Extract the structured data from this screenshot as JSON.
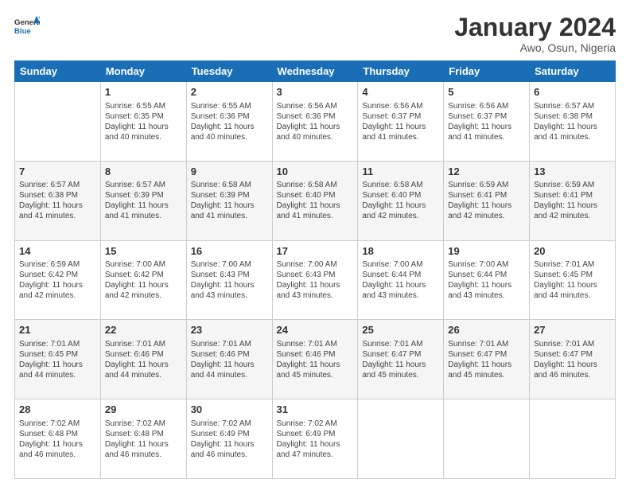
{
  "header": {
    "logo_text_general": "General",
    "logo_text_blue": "Blue",
    "month_title": "January 2024",
    "location": "Awo, Osun, Nigeria"
  },
  "days_of_week": [
    "Sunday",
    "Monday",
    "Tuesday",
    "Wednesday",
    "Thursday",
    "Friday",
    "Saturday"
  ],
  "weeks": [
    [
      {
        "day": "",
        "info": ""
      },
      {
        "day": "1",
        "info": "Sunrise: 6:55 AM\nSunset: 6:35 PM\nDaylight: 11 hours\nand 40 minutes."
      },
      {
        "day": "2",
        "info": "Sunrise: 6:55 AM\nSunset: 6:36 PM\nDaylight: 11 hours\nand 40 minutes."
      },
      {
        "day": "3",
        "info": "Sunrise: 6:56 AM\nSunset: 6:36 PM\nDaylight: 11 hours\nand 40 minutes."
      },
      {
        "day": "4",
        "info": "Sunrise: 6:56 AM\nSunset: 6:37 PM\nDaylight: 11 hours\nand 41 minutes."
      },
      {
        "day": "5",
        "info": "Sunrise: 6:56 AM\nSunset: 6:37 PM\nDaylight: 11 hours\nand 41 minutes."
      },
      {
        "day": "6",
        "info": "Sunrise: 6:57 AM\nSunset: 6:38 PM\nDaylight: 11 hours\nand 41 minutes."
      }
    ],
    [
      {
        "day": "7",
        "info": "Sunrise: 6:57 AM\nSunset: 6:38 PM\nDaylight: 11 hours\nand 41 minutes."
      },
      {
        "day": "8",
        "info": "Sunrise: 6:57 AM\nSunset: 6:39 PM\nDaylight: 11 hours\nand 41 minutes."
      },
      {
        "day": "9",
        "info": "Sunrise: 6:58 AM\nSunset: 6:39 PM\nDaylight: 11 hours\nand 41 minutes."
      },
      {
        "day": "10",
        "info": "Sunrise: 6:58 AM\nSunset: 6:40 PM\nDaylight: 11 hours\nand 41 minutes."
      },
      {
        "day": "11",
        "info": "Sunrise: 6:58 AM\nSunset: 6:40 PM\nDaylight: 11 hours\nand 42 minutes."
      },
      {
        "day": "12",
        "info": "Sunrise: 6:59 AM\nSunset: 6:41 PM\nDaylight: 11 hours\nand 42 minutes."
      },
      {
        "day": "13",
        "info": "Sunrise: 6:59 AM\nSunset: 6:41 PM\nDaylight: 11 hours\nand 42 minutes."
      }
    ],
    [
      {
        "day": "14",
        "info": "Sunrise: 6:59 AM\nSunset: 6:42 PM\nDaylight: 11 hours\nand 42 minutes."
      },
      {
        "day": "15",
        "info": "Sunrise: 7:00 AM\nSunset: 6:42 PM\nDaylight: 11 hours\nand 42 minutes."
      },
      {
        "day": "16",
        "info": "Sunrise: 7:00 AM\nSunset: 6:43 PM\nDaylight: 11 hours\nand 43 minutes."
      },
      {
        "day": "17",
        "info": "Sunrise: 7:00 AM\nSunset: 6:43 PM\nDaylight: 11 hours\nand 43 minutes."
      },
      {
        "day": "18",
        "info": "Sunrise: 7:00 AM\nSunset: 6:44 PM\nDaylight: 11 hours\nand 43 minutes."
      },
      {
        "day": "19",
        "info": "Sunrise: 7:00 AM\nSunset: 6:44 PM\nDaylight: 11 hours\nand 43 minutes."
      },
      {
        "day": "20",
        "info": "Sunrise: 7:01 AM\nSunset: 6:45 PM\nDaylight: 11 hours\nand 44 minutes."
      }
    ],
    [
      {
        "day": "21",
        "info": "Sunrise: 7:01 AM\nSunset: 6:45 PM\nDaylight: 11 hours\nand 44 minutes."
      },
      {
        "day": "22",
        "info": "Sunrise: 7:01 AM\nSunset: 6:46 PM\nDaylight: 11 hours\nand 44 minutes."
      },
      {
        "day": "23",
        "info": "Sunrise: 7:01 AM\nSunset: 6:46 PM\nDaylight: 11 hours\nand 44 minutes."
      },
      {
        "day": "24",
        "info": "Sunrise: 7:01 AM\nSunset: 6:46 PM\nDaylight: 11 hours\nand 45 minutes."
      },
      {
        "day": "25",
        "info": "Sunrise: 7:01 AM\nSunset: 6:47 PM\nDaylight: 11 hours\nand 45 minutes."
      },
      {
        "day": "26",
        "info": "Sunrise: 7:01 AM\nSunset: 6:47 PM\nDaylight: 11 hours\nand 45 minutes."
      },
      {
        "day": "27",
        "info": "Sunrise: 7:01 AM\nSunset: 6:47 PM\nDaylight: 11 hours\nand 46 minutes."
      }
    ],
    [
      {
        "day": "28",
        "info": "Sunrise: 7:02 AM\nSunset: 6:48 PM\nDaylight: 11 hours\nand 46 minutes."
      },
      {
        "day": "29",
        "info": "Sunrise: 7:02 AM\nSunset: 6:48 PM\nDaylight: 11 hours\nand 46 minutes."
      },
      {
        "day": "30",
        "info": "Sunrise: 7:02 AM\nSunset: 6:49 PM\nDaylight: 11 hours\nand 46 minutes."
      },
      {
        "day": "31",
        "info": "Sunrise: 7:02 AM\nSunset: 6:49 PM\nDaylight: 11 hours\nand 47 minutes."
      },
      {
        "day": "",
        "info": ""
      },
      {
        "day": "",
        "info": ""
      },
      {
        "day": "",
        "info": ""
      }
    ]
  ]
}
